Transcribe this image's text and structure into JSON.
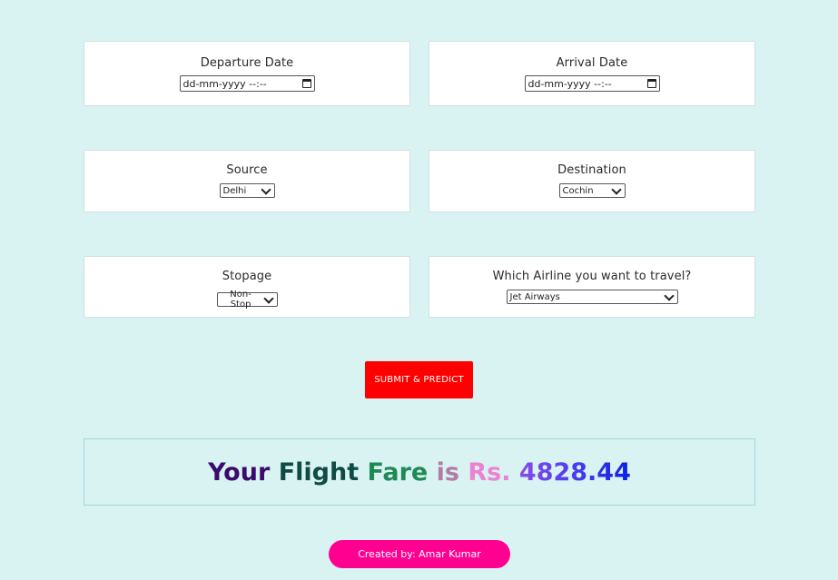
{
  "form": {
    "departure": {
      "label": "Departure Date",
      "placeholder": "dd-mm-yyyy --:--"
    },
    "arrival": {
      "label": "Arrival Date",
      "placeholder": "dd-mm-yyyy --:--"
    },
    "source": {
      "label": "Source",
      "value": "Delhi"
    },
    "destination": {
      "label": "Destination",
      "value": "Cochin"
    },
    "stopage": {
      "label": "Stopage",
      "value": "Non-Stop"
    },
    "airline": {
      "label": "Which Airline you want to travel?",
      "value": "Jet Airways"
    },
    "submit_label": "SUBMIT & PREDICT"
  },
  "result": {
    "words": [
      {
        "text": "Your",
        "color": "#3b0a6e"
      },
      {
        "text": "Flight",
        "color": "#0f4a45"
      },
      {
        "text": "Fare",
        "color": "#1f8a55"
      },
      {
        "text": "is",
        "color": "#b37aa6"
      },
      {
        "text": "Rs.",
        "color": "#ee82d2"
      },
      {
        "text": "4828.44",
        "color": "#7a3de8"
      }
    ]
  },
  "footer": {
    "credit": "Created by: Amar Kumar"
  },
  "colors": {
    "background": "#d9f3f2",
    "submit": "#ff0000",
    "credit": "#ff0090"
  }
}
